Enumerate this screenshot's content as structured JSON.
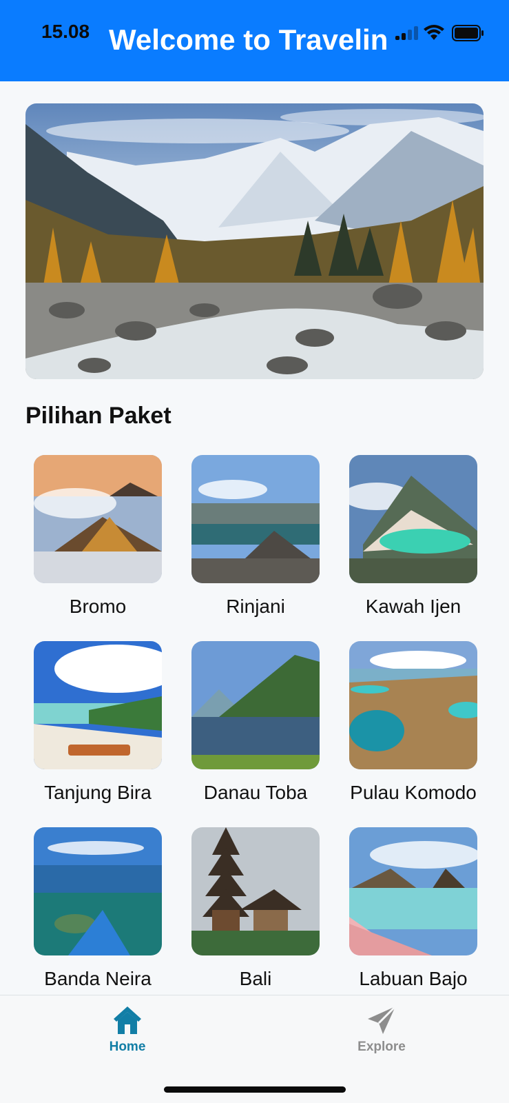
{
  "status_bar": {
    "time": "15.08"
  },
  "header": {
    "title": "Welcome to Travelin"
  },
  "hero": {
    "image": "mountain-river-landscape"
  },
  "section": {
    "title": "Pilihan Paket"
  },
  "packages": [
    {
      "name": "Bromo",
      "image": "volcano-crater"
    },
    {
      "name": "Rinjani",
      "image": "mountain-lake"
    },
    {
      "name": "Kawah Ijen",
      "image": "turquoise-crater-lake"
    },
    {
      "name": "Tanjung Bira",
      "image": "white-sand-beach"
    },
    {
      "name": "Danau Toba",
      "image": "lake-and-hills"
    },
    {
      "name": "Pulau Komodo",
      "image": "island-bays"
    },
    {
      "name": "Banda Neira",
      "image": "clear-sea-boat"
    },
    {
      "name": "Bali",
      "image": "temple-pagoda"
    },
    {
      "name": "Labuan Bajo",
      "image": "pink-beach"
    }
  ],
  "tabbar": {
    "home": {
      "label": "Home",
      "icon": "home-icon",
      "color": "#127ea6"
    },
    "explore": {
      "label": "Explore",
      "icon": "paper-plane-icon",
      "color": "#8d8d8d"
    }
  },
  "colors": {
    "accent": "#0a7cff",
    "active_tab": "#127ea6"
  }
}
